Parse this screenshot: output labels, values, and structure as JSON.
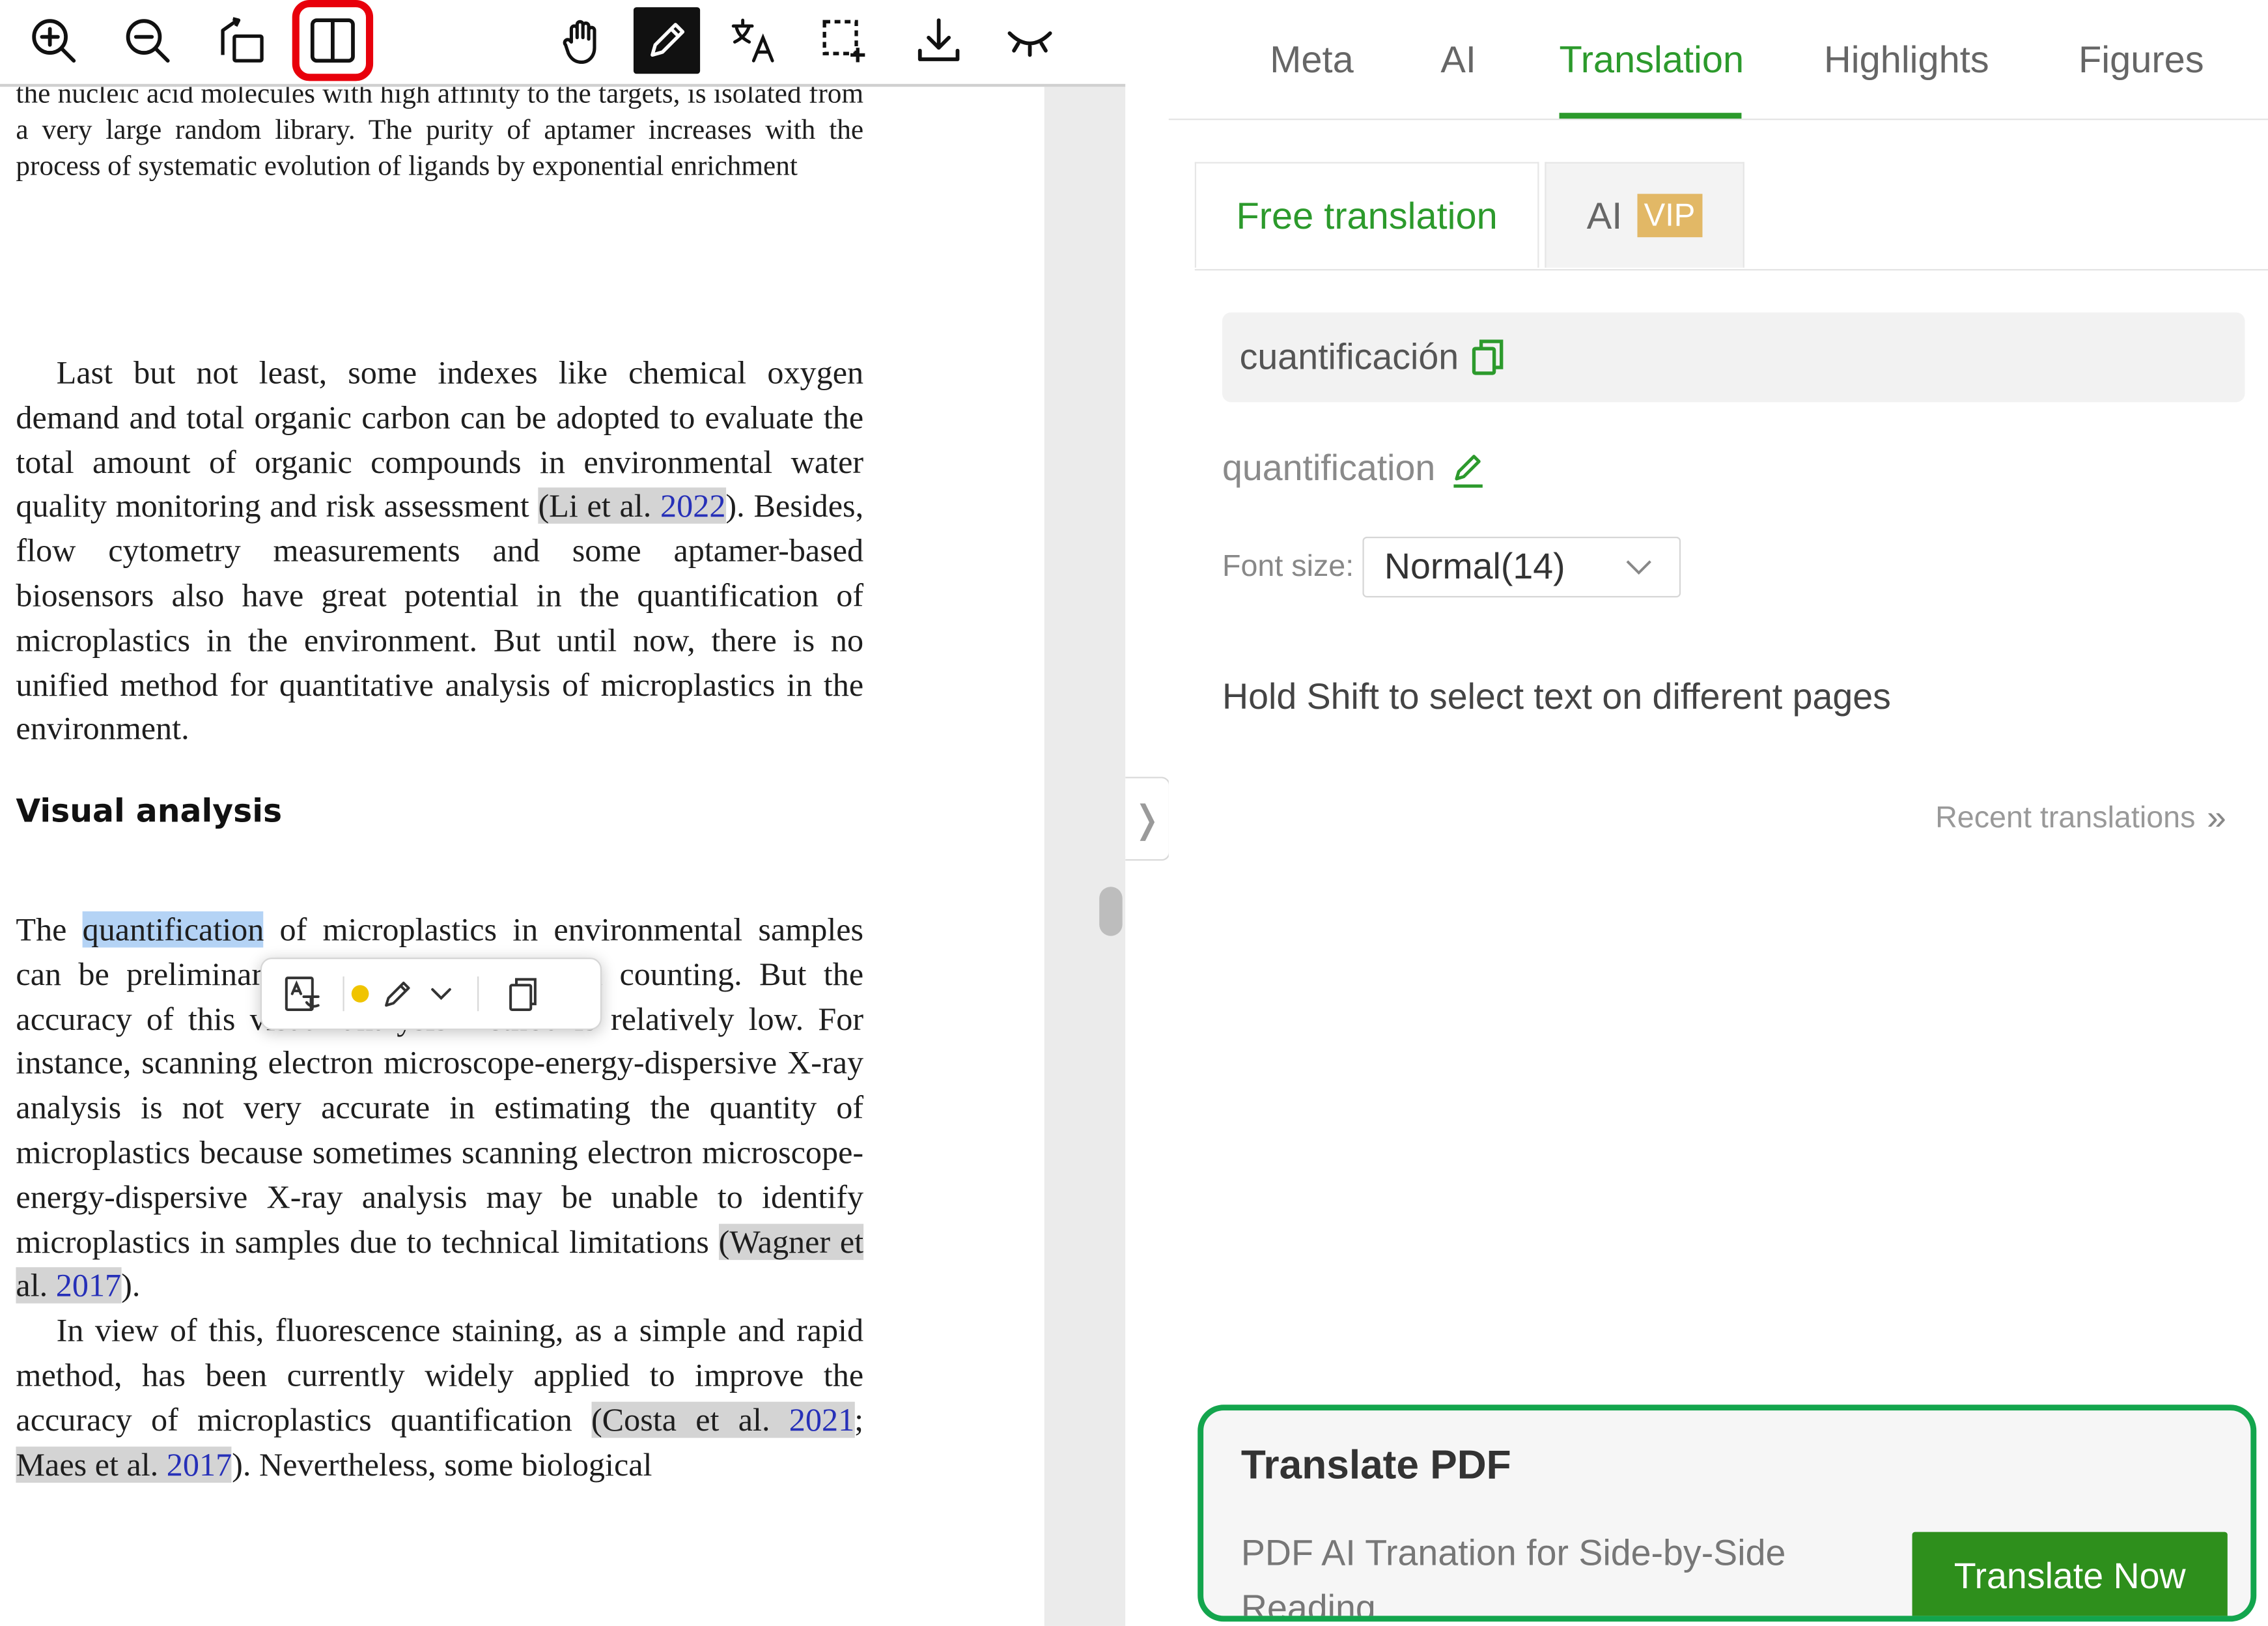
{
  "toolbar": {
    "buttons": [
      {
        "icon": "zoom-in-icon"
      },
      {
        "icon": "zoom-out-icon"
      },
      {
        "icon": "rotate-icon"
      },
      {
        "icon": "split-view-icon",
        "highlighted": true
      },
      {
        "icon": "hand-pan-icon"
      },
      {
        "icon": "pencil-icon",
        "active": true
      },
      {
        "icon": "translate-icon"
      },
      {
        "icon": "area-select-icon"
      },
      {
        "icon": "download-icon"
      },
      {
        "icon": "eye-closed-icon"
      }
    ],
    "highlight_color": "#e8000b"
  },
  "document": {
    "top_text": "the nucleic acid molecules with high affinity to the targets, is isolated from a very large random library. The purity of aptamer increases with the process of systematic evolution of ligands by exponential enrichment",
    "p1": {
      "a": "Last but not least, some indexes like chemical oxygen demand and total organic carbon can be adopted to evaluate the total amount of organic compounds in environmental water quality monitoring and risk assessment ",
      "cite_open": "(Li et al. ",
      "cite_year": "2022",
      "b": "). Besides, flow cytometry measurements and some aptamer-based biosensors also have great potential in the quantification of microplastics in the environment. But until now, there is no unified method for quantitative analysis of microplastics in the environment."
    },
    "heading": "Visual analysis",
    "p2": {
      "a": "The ",
      "selected": "quantification",
      "b": " of microplastics in environmental samples can be preliminarily estimated by manual counting. But the accuracy of this visual analysis method is relatively low. For instance, scanning electron microscope-energy-dispersive X-ray analysis is not very accurate in estimating the quantity of microplastics because sometimes scanning electron microscope-energy-dispersive X-ray analysis may be unable to identify microplastics in samples due to technical limitations ",
      "cite_name": "(Wagner et al. ",
      "cite_year": "2017",
      "c": ")."
    },
    "p3": {
      "a": "In view of this, fluorescence staining, as a simple and rapid method, has been currently widely applied to improve the accuracy of microplastics quantification ",
      "cite1_name": "(Costa et al. ",
      "cite1_year": "2021",
      "sep": "; ",
      "cite2_name": "Maes et al. ",
      "cite2_year": "2017",
      "d": "). Nevertheless, some biological"
    },
    "selected_color": "#b4d3f5",
    "citation_bg": "#d4d4d4",
    "link_color": "#2630b8"
  },
  "selection_popup": {
    "icons": [
      "translate-icon",
      "highlight-dot-icon",
      "pen-icon",
      "chevron-down-icon",
      "copy-icon"
    ],
    "dot_color": "#f0c400"
  },
  "panel": {
    "tabs": [
      "Meta",
      "AI",
      "Translation",
      "Highlights",
      "Figures"
    ],
    "active_tab": "Translation",
    "subtabs": {
      "free": "Free translation",
      "ai": "AI",
      "vip": "VIP"
    },
    "source_text": "cuantificación",
    "result_text": "quantification",
    "font_size_label": "Font size:",
    "font_size_value": "Normal(14)",
    "hint": "Hold Shift to select text on different pages",
    "recent": "Recent translations",
    "accent_color": "#2c9a2c"
  },
  "promo": {
    "title": "Translate PDF",
    "description": "PDF AI Tranation for Side-by-Side Reading",
    "button": "Translate Now",
    "border_color": "#13a54d",
    "button_color": "#2e8f1c"
  }
}
